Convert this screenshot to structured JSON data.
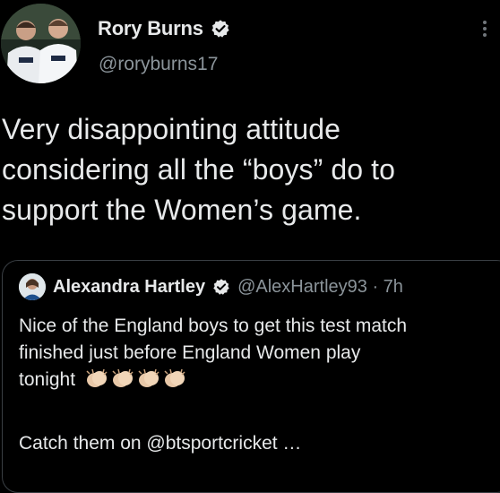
{
  "author": {
    "display_name": "Rory Burns",
    "handle": "@roryburns17"
  },
  "tweet": {
    "text": "Very disappointing attitude\nconsidering all the “boys” do to\nsupport the Women’s game."
  },
  "quoted": {
    "display_name": "Alexandra Hartley",
    "handle_time": "@AlexHartley93 · 7h",
    "text_line1": "Nice of the England boys to get this test match",
    "text_line2": "finished just before England Women play",
    "text_line3": "tonight",
    "emoji": "clapping-hands-emoji",
    "emoji_count": 4,
    "cta": "Catch them on @btsportcricket …"
  },
  "colors": {
    "background": "#000000",
    "text": "#e7e9ea",
    "muted": "#8b949a",
    "border": "#3a3f44",
    "verified": "#e7e9ea"
  },
  "icons": {
    "verified": "verified-badge-icon",
    "more": "more-vertical-icon"
  }
}
